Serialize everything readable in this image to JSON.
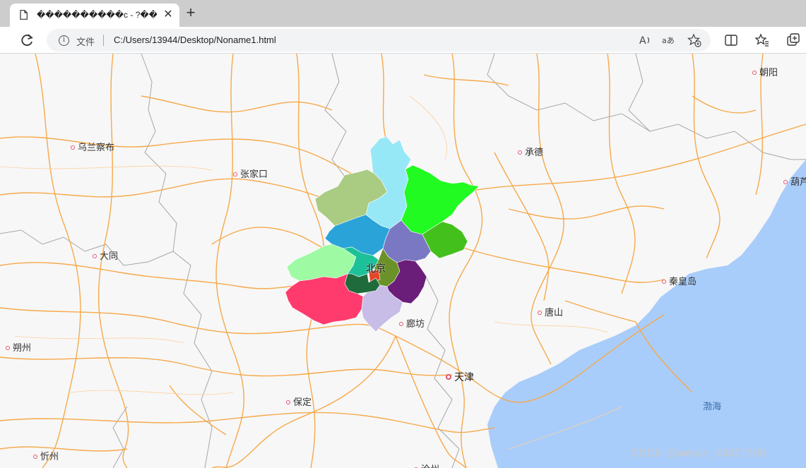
{
  "browser": {
    "tab_title": "����������c - ?��&�",
    "tab_close": "✕",
    "new_tab": "+",
    "address_label": "文件",
    "url": "C:/Users/13944/Desktop/Noname1.html",
    "icons": [
      "page-icon",
      "refresh-icon",
      "info-icon",
      "read-aloud-icon",
      "translate-icon",
      "add-favorite-icon",
      "split-screen-icon",
      "favorites-icon",
      "collections-icon"
    ]
  },
  "map": {
    "cities": [
      {
        "name": "朝阳"
      },
      {
        "name": "乌兰察布"
      },
      {
        "name": "承德"
      },
      {
        "name": "张家口"
      },
      {
        "name": "葫芦"
      },
      {
        "name": "大同"
      },
      {
        "name": "秦皇岛"
      },
      {
        "name": "唐山"
      },
      {
        "name": "廊坊"
      },
      {
        "name": "朔州"
      },
      {
        "name": "天津"
      },
      {
        "name": "保定"
      },
      {
        "name": "忻州"
      },
      {
        "name": "沧州"
      }
    ],
    "center_label": "北京",
    "sea_label": "渤海",
    "colors": {
      "sea": "#a9cdfa",
      "road": "#f6a94a",
      "district_colors": [
        "#97e8f6",
        "#aacb82",
        "#22fb22",
        "#2aa3d8",
        "#7b78c3",
        "#44c01d",
        "#9efba4",
        "#1cc19a",
        "#6b9228",
        "#e2452a",
        "#1f6b3c",
        "#6b1e79",
        "#ff3b6e",
        "#c8bde6"
      ]
    }
  },
  "watermark": "CSDN @weixin_43471769"
}
